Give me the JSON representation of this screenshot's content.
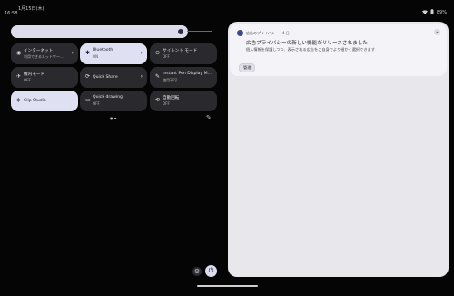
{
  "status": {
    "date": "1月15日(木)",
    "time": "16:58",
    "battery": "89%",
    "wifi_icon": "wifi-icon",
    "battery_icon": "battery-icon"
  },
  "tiles": [
    {
      "title": "インターネット",
      "subtitle": "利用できるネットワー...",
      "icon": "wifi-icon",
      "glyph": "◉",
      "on": false,
      "chevron": true
    },
    {
      "title": "Bluetooth",
      "subtitle": "ON",
      "icon": "bluetooth-icon",
      "glyph": "✱",
      "on": true,
      "chevron": true
    },
    {
      "title": "サイレント モード",
      "subtitle": "OFF",
      "icon": "do-not-disturb-icon",
      "glyph": "⊖",
      "on": false,
      "chevron": false
    },
    {
      "title": "機内モード",
      "subtitle": "OFF",
      "icon": "airplane-icon",
      "glyph": "✈",
      "on": false,
      "chevron": false
    },
    {
      "title": "Quick Share",
      "subtitle": "",
      "icon": "quick-share-icon",
      "glyph": "⟳",
      "on": false,
      "chevron": true
    },
    {
      "title": "Instant Pen Display M...",
      "subtitle": "使用不可",
      "icon": "pen-display-icon",
      "glyph": "✎",
      "on": false,
      "chevron": false
    },
    {
      "title": "Clip Studio",
      "subtitle": "",
      "icon": "clip-studio-icon",
      "glyph": "◈",
      "on": true,
      "chevron": false
    },
    {
      "title": "Quick drawing",
      "subtitle": "OFF",
      "icon": "quick-drawing-icon",
      "glyph": "▭",
      "on": false,
      "chevron": false
    },
    {
      "title": "自動回転",
      "subtitle": "OFF",
      "icon": "auto-rotate-icon",
      "glyph": "⟲",
      "on": false,
      "chevron": false
    }
  ],
  "pager": "● ▪",
  "edit_glyph": "✎",
  "notification": {
    "app_name": "広告のプライバシー・4 日",
    "title": "広告プライバシーの新しい機能がリリースされました",
    "body": "個人情報を保護しつつ、表示される広告をご自身でより細かく選択できます",
    "action": "管理",
    "expand_glyph": "⌄"
  },
  "buttons": {
    "settings_glyph": "⚙",
    "power_glyph": "⏻"
  },
  "colors": {
    "tile_on": "#dfe0f2",
    "tile_off": "#2a2a2e",
    "panel": "#e8e7ec",
    "background": "#050505"
  }
}
